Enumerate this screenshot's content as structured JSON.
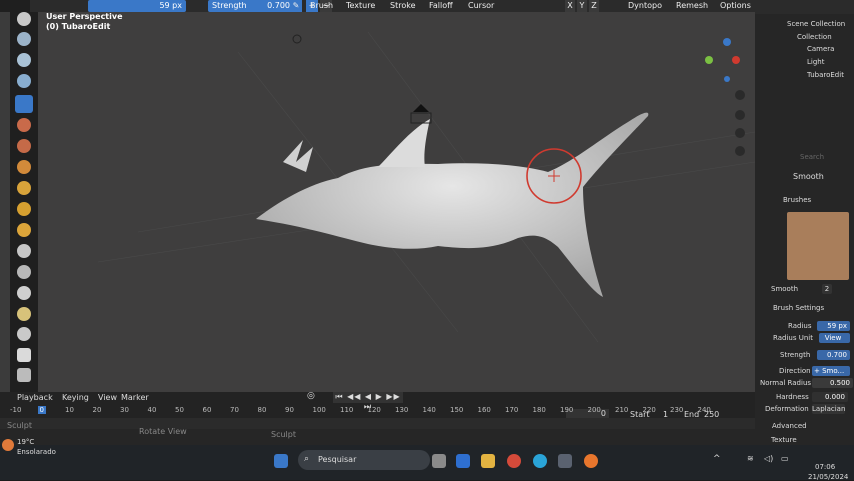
{
  "header": {
    "radius_value": "59 px",
    "strength_label": "Strength",
    "strength_value": "0.700",
    "menus": [
      "Brush",
      "Texture",
      "Stroke",
      "Falloff",
      "Cursor"
    ],
    "axes": [
      "X",
      "Y",
      "Z"
    ],
    "dyntopo": "Dyntopo",
    "remesh": "Remesh",
    "options": "Options"
  },
  "viewport": {
    "perspective": "User Perspective",
    "object": "(0) TubaroEdit"
  },
  "outliner": {
    "title": "Scene Collection",
    "collection": "Collection",
    "items": [
      "Camera",
      "Light",
      "TubaroEdit"
    ],
    "search_placeholder": "Search"
  },
  "properties": {
    "brush_name": "Smooth",
    "brushes_header": "Brushes",
    "thumb_label": "Smooth",
    "thumb_count": "2",
    "brush_settings": "Brush Settings",
    "radius_label": "Radius",
    "radius_value": "59 px",
    "radius_unit_label": "Radius Unit",
    "radius_unit_value": "View",
    "strength_label": "Strength",
    "strength_value": "0.700",
    "direction_label": "Direction",
    "direction_value": "+ Smo...",
    "normal_radius_label": "Normal Radius",
    "normal_radius_value": "0.500",
    "hardness_label": "Hardness",
    "hardness_value": "0.000",
    "deformation_label": "Deformation",
    "deformation_value": "Laplacian",
    "advanced": "Advanced",
    "texture": "Texture"
  },
  "timeline": {
    "menus": [
      "Playback",
      "Keying",
      "View",
      "Marker"
    ],
    "current_frame": "0",
    "start_label": "Start",
    "start_value": "1",
    "end_label": "End",
    "end_value": "250",
    "ticks": [
      "-10",
      "0",
      "10",
      "20",
      "30",
      "40",
      "50",
      "60",
      "70",
      "80",
      "90",
      "100",
      "110",
      "120",
      "130",
      "140",
      "150",
      "160",
      "170",
      "180",
      "190",
      "200",
      "210",
      "220",
      "230",
      "240"
    ],
    "status_sculpt": "Sculpt",
    "status_rotate": "Rotate View",
    "status_sculpt2": "Sculpt"
  },
  "taskbar": {
    "weather_temp": "19°C",
    "weather_desc": "Ensolarado",
    "search": "Pesquisar",
    "time": "07:06",
    "date": "21/05/2024"
  },
  "colors": {
    "accent": "#3a78c8",
    "brush_circle": "#d03a2f",
    "mesh": "#d8d8d8",
    "viewport_bg": "#3f3e3e"
  }
}
